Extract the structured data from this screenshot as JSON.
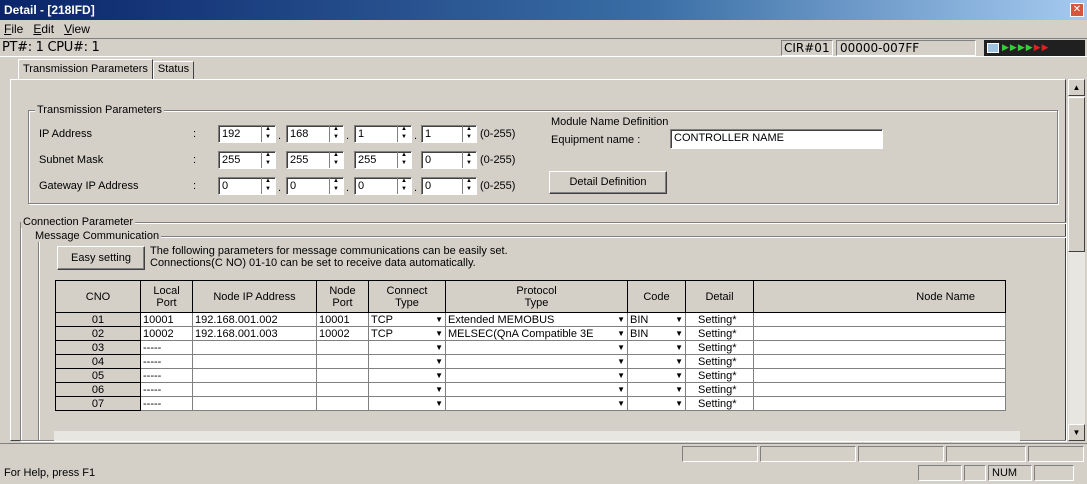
{
  "window": {
    "title": "Detail - [218IFD]"
  },
  "menu": [
    "File",
    "Edit",
    "View"
  ],
  "info": {
    "pt_cpu": "PT#: 1 CPU#: 1",
    "cir": "CIR#01",
    "address_range": "00000-007FF"
  },
  "tabs": [
    "Transmission Parameters",
    "Status"
  ],
  "transmission": {
    "group_label": "Transmission Parameters",
    "rows": [
      {
        "label": "IP Address",
        "values": [
          "192",
          "168",
          "1",
          "1"
        ],
        "range": "(0-255)"
      },
      {
        "label": "Subnet Mask",
        "values": [
          "255",
          "255",
          "255",
          "0"
        ],
        "range": "(0-255)"
      },
      {
        "label": "Gateway IP Address",
        "values": [
          "0",
          "0",
          "0",
          "0"
        ],
        "range": "(0-255)"
      }
    ],
    "module_name_title": "Module Name Definition",
    "equipment_label": "Equipment name :",
    "equipment_value": "CONTROLLER NAME",
    "detail_button": "Detail Definition"
  },
  "connection": {
    "group_label": "Connection Parameter",
    "message_group_label": "Message Communication",
    "easy_button": "Easy setting",
    "desc_line1": "The following parameters for message communications can be easily set.",
    "desc_line2": "Connections(C NO) 01-10 can be set to receive data automatically.",
    "columns": {
      "cno": "CNO",
      "local_port_1": "Local",
      "local_port_2": "Port",
      "node_ip": "Node IP Address",
      "node_port_1": "Node",
      "node_port_2": "Port",
      "connect_type_1": "Connect",
      "connect_type_2": "Type",
      "protocol_1": "Protocol",
      "protocol_2": "Type",
      "code": "Code",
      "detail": "Detail",
      "node_name": "Node Name"
    },
    "rows": [
      {
        "cno": "01",
        "local_port": "10001",
        "node_ip": "192.168.001.002",
        "node_port": "10001",
        "connect_type": "TCP",
        "protocol": "Extended MEMOBUS",
        "code": "BIN",
        "detail": "Setting*",
        "node_name": ""
      },
      {
        "cno": "02",
        "local_port": "10002",
        "node_ip": "192.168.001.003",
        "node_port": "10002",
        "connect_type": "TCP",
        "protocol": "MELSEC(QnA Compatible 3E",
        "code": "BIN",
        "detail": "Setting*",
        "node_name": ""
      },
      {
        "cno": "03",
        "local_port": "-----",
        "node_ip": "",
        "node_port": "",
        "connect_type": "",
        "protocol": "",
        "code": "",
        "detail": "Setting*",
        "node_name": ""
      },
      {
        "cno": "04",
        "local_port": "-----",
        "node_ip": "",
        "node_port": "",
        "connect_type": "",
        "protocol": "",
        "code": "",
        "detail": "Setting*",
        "node_name": ""
      },
      {
        "cno": "05",
        "local_port": "-----",
        "node_ip": "",
        "node_port": "",
        "connect_type": "",
        "protocol": "",
        "code": "",
        "detail": "Setting*",
        "node_name": ""
      },
      {
        "cno": "06",
        "local_port": "-----",
        "node_ip": "",
        "node_port": "",
        "connect_type": "",
        "protocol": "",
        "code": "",
        "detail": "Setting*",
        "node_name": ""
      },
      {
        "cno": "07",
        "local_port": "-----",
        "node_ip": "",
        "node_port": "",
        "connect_type": "",
        "protocol": "",
        "code": "",
        "detail": "Setting*",
        "node_name": ""
      }
    ]
  },
  "status": {
    "help": "For Help, press F1",
    "num": "NUM"
  }
}
